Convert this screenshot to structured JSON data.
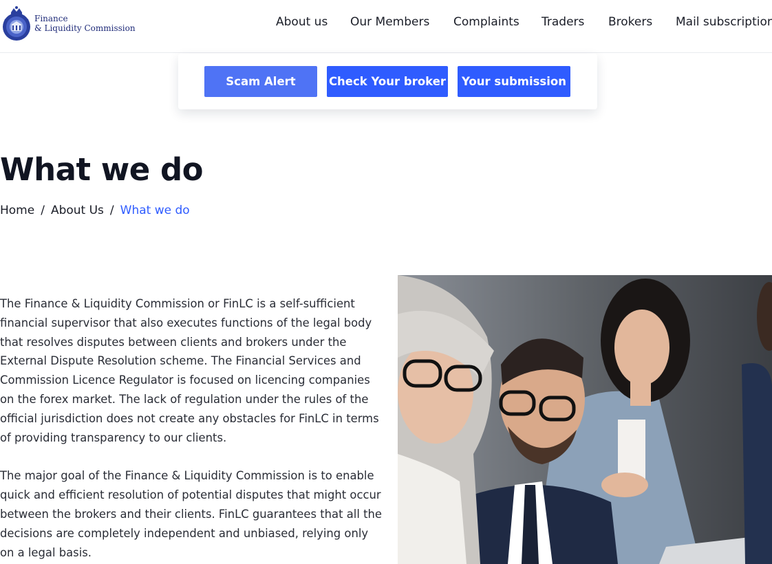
{
  "brand": {
    "line1": "Finance",
    "line2": "& Liquidity Commission"
  },
  "nav": {
    "items": [
      {
        "label": "About us"
      },
      {
        "label": "Our Members"
      },
      {
        "label": "Complaints"
      },
      {
        "label": "Traders"
      },
      {
        "label": "Brokers"
      },
      {
        "label": "Mail subscription"
      }
    ]
  },
  "actions": {
    "scam_alert": "Scam Alert",
    "check_broker": "Check Your broker",
    "submission": "Your submission"
  },
  "page": {
    "title": "What we do",
    "breadcrumb": {
      "home": "Home",
      "about": "About Us",
      "current": "What we do",
      "separator": "/"
    }
  },
  "content": {
    "paragraphs": [
      "The Finance & Liquidity Commission or FinLC is a self-sufficient financial supervisor that also executes functions of the legal body that resolves disputes between clients and brokers under the External Dispute Resolution scheme. The Financial Services and Commission Licence Regulator is focused on licencing companies on the forex market. The lack of regulation under the rules of the official jurisdiction does not create any obstacles for FinLC in terms of providing transparency to our clients.",
      "The major goal of the Finance & Liquidity Commission is to enable quick and efficient resolution of potential disputes that might occur between the brokers and their clients. FinLC guarantees that all the decisions are completely independent and unbiased, relying only on a legal basis."
    ]
  },
  "colors": {
    "primary": "#2f5cff",
    "scam_button": "#4f73f5",
    "logo_blue": "#1e2a78"
  },
  "icons": {
    "logo": "crest-icon"
  }
}
